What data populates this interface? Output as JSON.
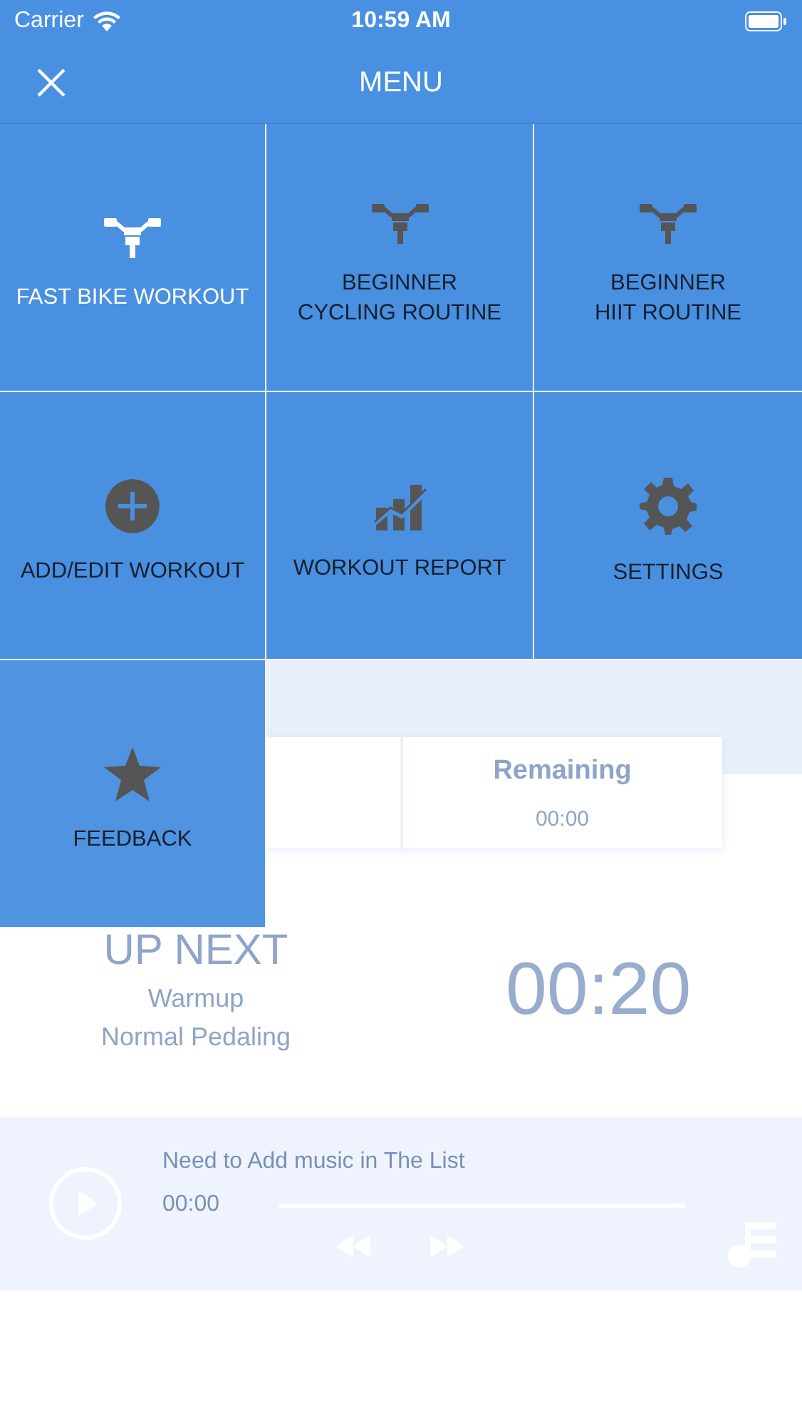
{
  "status_bar": {
    "carrier": "Carrier",
    "time": "10:59 AM"
  },
  "header": {
    "title": "MENU"
  },
  "menu_tiles": [
    {
      "label": "FAST BIKE WORKOUT",
      "kind": "bike",
      "selected": true
    },
    {
      "label": "BEGINNER\nCYCLING ROUTINE",
      "kind": "bike",
      "selected": false
    },
    {
      "label": "BEGINNER\nHIIT ROUTINE",
      "kind": "bike",
      "selected": false
    },
    {
      "label": "ADD/EDIT WORKOUT",
      "kind": "plus",
      "selected": false
    },
    {
      "label": "WORKOUT REPORT",
      "kind": "chart",
      "selected": false
    },
    {
      "label": "SETTINGS",
      "kind": "gear",
      "selected": false
    },
    {
      "label": "FEEDBACK",
      "kind": "star",
      "selected": false
    }
  ],
  "stats": {
    "remaining_label": "Remaining",
    "remaining_value": "00:00"
  },
  "up_next": {
    "title": "UP NEXT",
    "lines": [
      "Warmup",
      "Normal Pedaling"
    ],
    "time": "00:20"
  },
  "music": {
    "message": "Need to Add music in The List",
    "elapsed": "00:00"
  }
}
